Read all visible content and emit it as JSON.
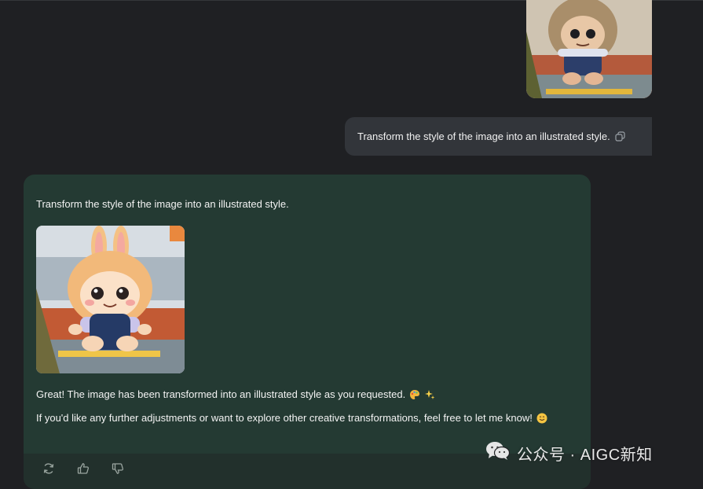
{
  "user_message": {
    "text": "Transform the style of the image into an illustrated style.",
    "copy_icon": "copy-icon"
  },
  "assistant": {
    "prompt_echo": "Transform the style of the image into an illustrated style.",
    "reply_line1": "Great! The image has been transformed into an illustrated style as you requested.",
    "reply_line2": "If you'd like any further adjustments or want to explore other creative transformations, feel free to let me know!",
    "emoji_line1": [
      "palette-emoji",
      "sparkles-emoji"
    ],
    "emoji_line2": "smile-emoji"
  },
  "actions": [
    {
      "name": "regenerate",
      "icon": "refresh-icon"
    },
    {
      "name": "like",
      "icon": "thumbs-up-icon"
    },
    {
      "name": "dislike",
      "icon": "thumbs-down-icon"
    }
  ],
  "watermark": {
    "text": "公众号 · AIGC新知",
    "icon": "wechat-icon"
  },
  "colors": {
    "background": "#1f2023",
    "user_bubble": "#32353a",
    "assistant_card": "#243a33",
    "action_bar": "#22302c"
  }
}
